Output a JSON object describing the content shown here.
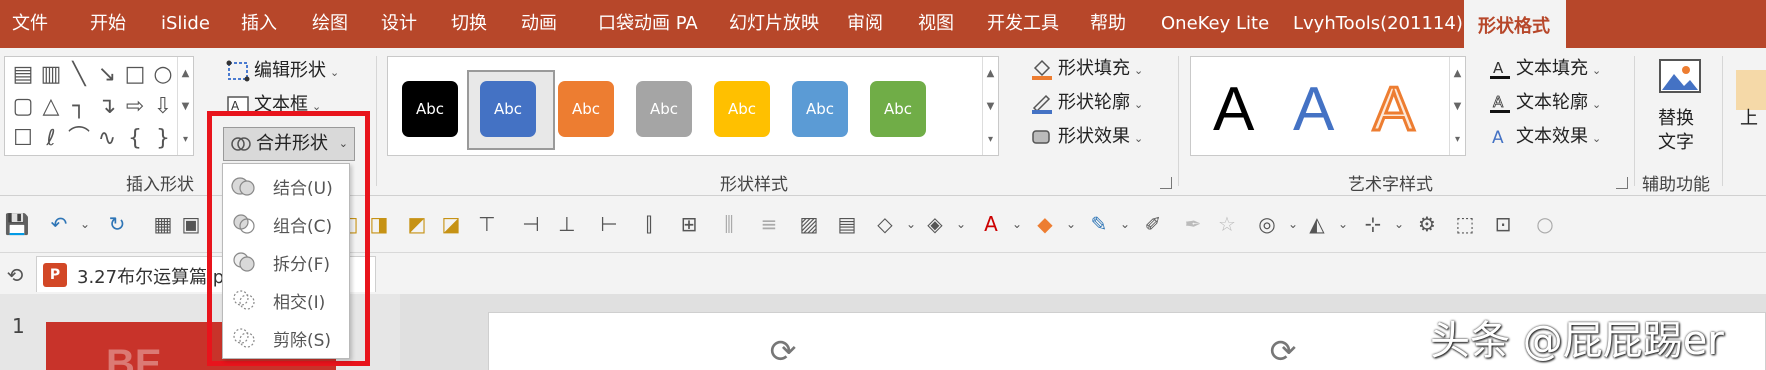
{
  "tabs": [
    "文件",
    "开始",
    "iSlide",
    "插入",
    "绘图",
    "设计",
    "切换",
    "动画",
    "口袋动画 PA",
    "幻灯片放映",
    "审阅",
    "视图",
    "开发工具",
    "帮助",
    "OneKey Lite",
    "LvyhTools(201114)"
  ],
  "active_tab": "形状格式",
  "ribbon": {
    "insert_shapes": {
      "label": "插入形状",
      "edit_shape": "编辑形状",
      "text_box": "文本框",
      "merge_shapes": "合并形状"
    },
    "shape_styles": {
      "label": "形状样式",
      "swatch_text": "Abc",
      "swatch_colors": [
        "#000000",
        "#4472c4",
        "#ed7d31",
        "#a5a5a5",
        "#ffc000",
        "#5b9bd5",
        "#70ad47"
      ],
      "fill": "形状填充",
      "outline": "形状轮廓",
      "effects": "形状效果"
    },
    "wordart": {
      "label": "艺术字样式",
      "letter": "A",
      "text_fill": "文本填充",
      "text_outline": "文本轮廓",
      "text_effects": "文本效果"
    },
    "accessibility": {
      "label": "辅助功能",
      "alt_text_line1": "替换",
      "alt_text_line2": "文字"
    },
    "cut_off_label": "上"
  },
  "merge_menu": {
    "items": [
      "结合(U)",
      "组合(C)",
      "拆分(F)",
      "相交(I)",
      "剪除(S)"
    ]
  },
  "document": {
    "tab_title": "3.27布尔运算篇.p",
    "slide_number": "1",
    "thumbnail_text": "BE"
  },
  "watermark": "头条 @屁屁踢er",
  "accent_color": "#b7472a",
  "highlight_color": "#e8141c"
}
